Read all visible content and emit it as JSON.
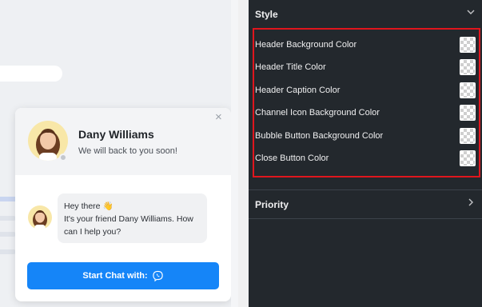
{
  "preview": {
    "agent_name": "Dany Williams",
    "agent_caption": "We will back to you soon!",
    "close_glyph": "×",
    "message_lines": [
      "Hey there 👋",
      "It's your friend Dany Williams. How",
      "can I help you?"
    ],
    "start_button_label": "Start Chat with:",
    "start_button_icon": "viber-icon",
    "accent_color": "#1585f8"
  },
  "style_section": {
    "title": "Style",
    "icon": "chevron-down-icon",
    "color_settings": [
      {
        "label": "Header Background Color"
      },
      {
        "label": "Header Title Color"
      },
      {
        "label": "Header Caption Color"
      },
      {
        "label": "Channel Icon Background Color"
      },
      {
        "label": "Bubble Button Background Color"
      },
      {
        "label": "Close Button Color"
      }
    ],
    "highlight_color": "#e0161d"
  },
  "priority_section": {
    "title": "Priority",
    "icon": "chevron-right-icon"
  },
  "panel_color": "#23282d"
}
